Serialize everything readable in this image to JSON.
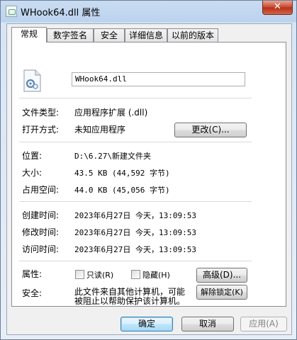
{
  "window": {
    "title": "WHook64.dll 属性",
    "close_label": "✕"
  },
  "tabs": [
    {
      "label": "常规"
    },
    {
      "label": "数字签名"
    },
    {
      "label": "安全"
    },
    {
      "label": "详细信息"
    },
    {
      "label": "以前的版本"
    }
  ],
  "general": {
    "file_name": "WHook64.dll",
    "file_type_label": "文件类型:",
    "file_type_value": "应用程序扩展 (.dll)",
    "opens_with_label": "打开方式:",
    "opens_with_value": "未知应用程序",
    "change_button": "更改(C)...",
    "location_label": "位置:",
    "location_value": "D:\\6.27\\新建文件夹",
    "size_label": "大小:",
    "size_value": "43.5 KB (44,592 字节)",
    "size_on_disk_label": "占用空间:",
    "size_on_disk_value": "44.0 KB (45,056 字节)",
    "created_label": "创建时间:",
    "created_value": "2023年6月27日 今天，13:09:53",
    "modified_label": "修改时间:",
    "modified_value": "2023年6月27日 今天，13:09:53",
    "accessed_label": "访问时间:",
    "accessed_value": "2023年6月27日 今天，13:09:53",
    "attributes_label": "属性:",
    "readonly_label": "只读(R)",
    "hidden_label": "隐藏(H)",
    "advanced_button": "高级(D)...",
    "security_label": "安全:",
    "security_text_line1": "此文件来自其他计算机，可能",
    "security_text_line2": "被阻止以帮助保护该计算机。",
    "unblock_button": "解除锁定(K)"
  },
  "footer": {
    "ok_button": "确定",
    "cancel_button": "取消",
    "apply_button": "应用(A)"
  },
  "colors": {
    "window_frame": "#bcd3ee",
    "close_button": "#c7432b",
    "default_button": "#3c7fb1"
  }
}
